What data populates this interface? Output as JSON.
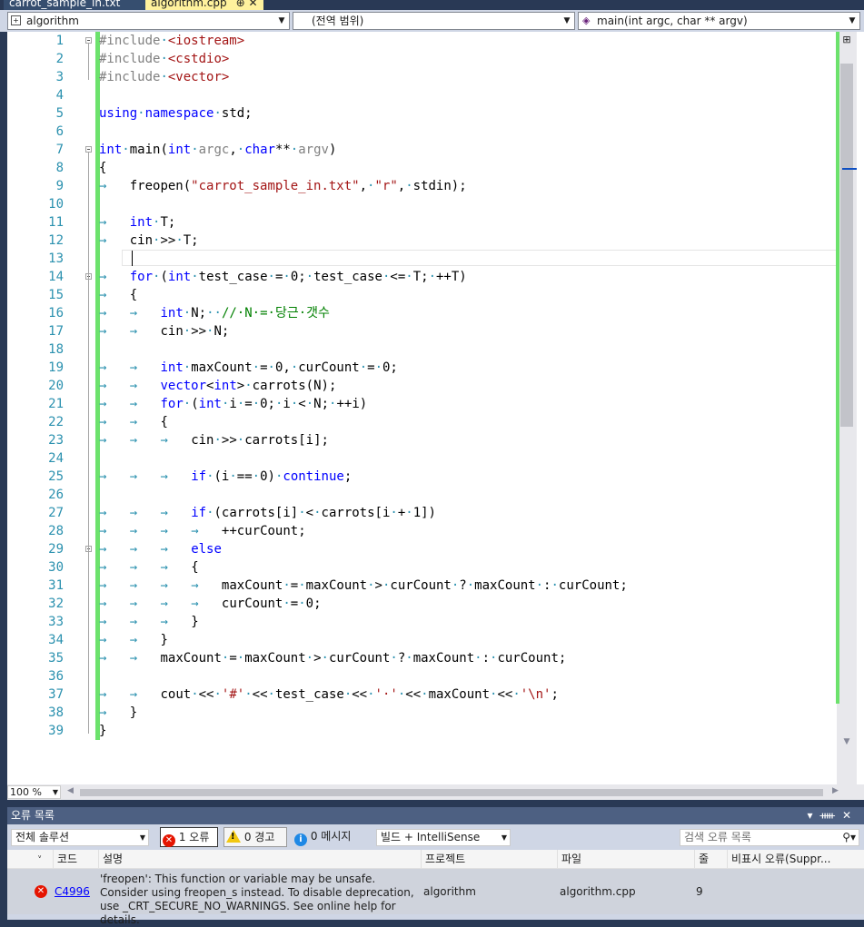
{
  "tabs": [
    {
      "label": "carrot_sample_in.txt"
    },
    {
      "label": "algorithm.cpp",
      "pin_icon": "pin-icon",
      "close_icon": "close-icon"
    }
  ],
  "navbar": {
    "project": "algorithm",
    "scope": "(전역 범위)",
    "member": "main(int argc, char ** argv)"
  },
  "editor": {
    "line_numbers": [
      "1",
      "2",
      "3",
      "4",
      "5",
      "6",
      "7",
      "8",
      "9",
      "10",
      "11",
      "12",
      "13",
      "14",
      "15",
      "16",
      "17",
      "18",
      "19",
      "20",
      "21",
      "22",
      "23",
      "24",
      "25",
      "26",
      "27",
      "28",
      "29",
      "30",
      "31",
      "32",
      "33",
      "34",
      "35",
      "36",
      "37",
      "38",
      "39"
    ],
    "code_lines": [
      "#include·<iostream>",
      "#include·<cstdio>",
      "#include·<vector>",
      "",
      "using·namespace·std;",
      "",
      "int·main(int·argc,·char**·argv)",
      "{",
      "→   freopen(\"carrot_sample_in.txt\",·\"r\",·stdin);",
      "",
      "→   int·T;",
      "→   cin·>>·T;",
      "",
      "→   for·(int·test_case·=·0;·test_case·<=·T;·++T)",
      "→   {",
      "→   →   int·N;··//·N·=·당근·갯수",
      "→   →   cin·>>·N;",
      "",
      "→   →   int·maxCount·=·0,·curCount·=·0;",
      "→   →   vector<int>·carrots(N);",
      "→   →   for·(int·i·=·0;·i·<·N;·++i)",
      "→   →   {",
      "→   →   →   cin·>>·carrots[i];",
      "",
      "→   →   →   if·(i·==·0)·continue;",
      "",
      "→   →   →   if·(carrots[i]·<·carrots[i·+·1])",
      "→   →   →   →   ++curCount;",
      "→   →   →   else",
      "→   →   →   {",
      "→   →   →   →   maxCount·=·maxCount·>·curCount·?·maxCount·:·curCount;",
      "→   →   →   →   curCount·=·0;",
      "→   →   →   }",
      "→   →   }",
      "→   →   maxCount·=·maxCount·>·curCount·?·maxCount·:·curCount;",
      "",
      "→   →   cout·<<·'#'·<<·test_case·<<·'·'·<<·maxCount·<<·'\\n';",
      "→   }",
      "}"
    ]
  },
  "zoom": "100 %",
  "error_list": {
    "title": "오류 목록",
    "scope_filter": "전체 솔루션",
    "errors_label": "1 오류",
    "warnings_label": "0 경고",
    "messages_label": "0 메시지",
    "build_filter": "빌드 + IntelliSense",
    "search_placeholder": "검색 오류 목록",
    "columns": [
      "코드",
      "설명",
      "프로젝트",
      "파일",
      "줄",
      "비표시 오류(Suppr..."
    ],
    "rows": [
      {
        "code": "C4996",
        "description": "'freopen': This function or variable may be unsafe. Consider using freopen_s instead. To disable deprecation, use _CRT_SECURE_NO_WARNINGS. See online help for details.",
        "project": "algorithm",
        "file": "algorithm.cpp",
        "line": "9",
        "suppression": ""
      }
    ]
  },
  "colors": {
    "keyword": "#0000ff",
    "preprocessor": "#808080",
    "string": "#a31515",
    "comment": "#008000",
    "line_number": "#2b91af",
    "change_bar": "#6ce26c"
  }
}
